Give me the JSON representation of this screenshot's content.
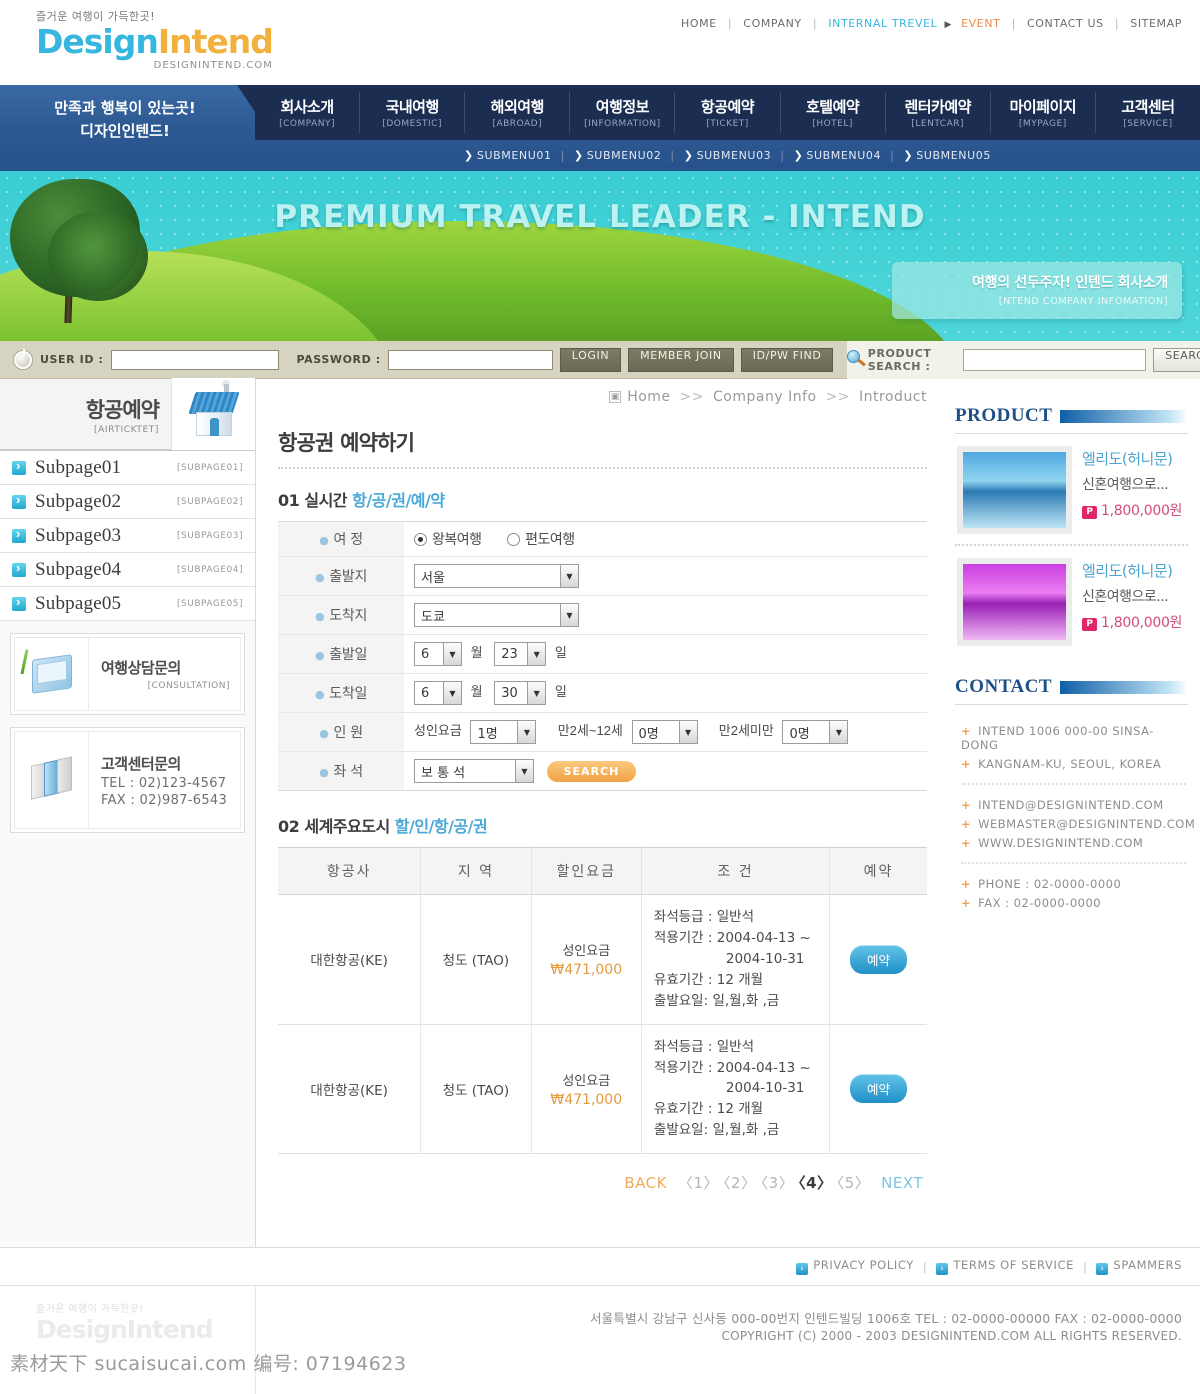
{
  "header": {
    "logo_tagline": "즐거운 여행이 가득한곳!",
    "logo_part1": "Design",
    "logo_part2": "Intend",
    "logo_domain": "DESIGNINTEND.COM",
    "topnav": [
      {
        "label": "HOME",
        "style": "plain"
      },
      {
        "label": "COMPANY",
        "style": "plain"
      },
      {
        "label": "INTERNAL TREVEL",
        "style": "blue"
      },
      {
        "label": "EVENT",
        "style": "orange"
      },
      {
        "label": "CONTACT US",
        "style": "plain"
      },
      {
        "label": "SITEMAP",
        "style": "plain"
      }
    ]
  },
  "navband": {
    "slogan_line1": "만족과 행복이 있는곳!",
    "slogan_line2": "디자인인텐드!",
    "menu": [
      {
        "ko": "회사소개",
        "en": "[COMPANY]"
      },
      {
        "ko": "국내여행",
        "en": "[DOMESTIC]"
      },
      {
        "ko": "해외여행",
        "en": "[ABROAD]"
      },
      {
        "ko": "여행정보",
        "en": "[INFORMATION]"
      },
      {
        "ko": "항공예약",
        "en": "[TICKET]"
      },
      {
        "ko": "호텔예약",
        "en": "[HOTEL]"
      },
      {
        "ko": "렌터카예약",
        "en": "[LENTCAR]"
      },
      {
        "ko": "마이페이지",
        "en": "[MYPAGE]"
      },
      {
        "ko": "고객센터",
        "en": "[SERVICE]"
      }
    ],
    "submenu": [
      "SUBMENU01",
      "SUBMENU02",
      "SUBMENU03",
      "SUBMENU04",
      "SUBMENU05"
    ]
  },
  "banner": {
    "title": "PREMIUM TRAVEL LEADER - INTEND",
    "callout_ko": "여행의 선두주자! 인텐드 회사소개",
    "callout_en": "[NTEND COMPANY INFOMATION]"
  },
  "loginbar": {
    "userid_label": "USER ID :",
    "userid_value": "",
    "password_label": "PASSWORD :",
    "password_value": "",
    "login_button": "LOGIN",
    "member_join_button": "MEMBER JOIN",
    "idpw_find_button": "ID/PW FIND",
    "product_search_label": "PRODUCT SEARCH :",
    "product_search_value": "",
    "search_button": "SEARCH"
  },
  "sidebar": {
    "head_ko": "항공예약",
    "head_en": "[AIRTICKTET]",
    "items": [
      {
        "label": "Subpage01",
        "code": "[SUBPAGE01]"
      },
      {
        "label": "Subpage02",
        "code": "[SUBPAGE02]"
      },
      {
        "label": "Subpage03",
        "code": "[SUBPAGE03]"
      },
      {
        "label": "Subpage04",
        "code": "[SUBPAGE04]"
      },
      {
        "label": "Subpage05",
        "code": "[SUBPAGE05]"
      }
    ],
    "consultation": {
      "ko": "여행상담문의",
      "en": "[CONSULTATION]"
    },
    "service_center": {
      "ko": "고객센터문의",
      "tel": "TEL : 02)123-4567",
      "fax": "FAX : 02)987-6543"
    }
  },
  "main": {
    "breadcrumb": [
      "Home",
      "Company Info",
      "Introduct"
    ],
    "breadcrumb_sep": ">>",
    "page_title": "항공권 예약하기",
    "section1": {
      "number": "01",
      "text": "실시간",
      "highlight": "항/공/권/예/약",
      "rows": {
        "itinerary_label": "여  정",
        "itinerary_opt1": "왕복여행",
        "itinerary_opt2": "편도여행",
        "departure_label": "출발지",
        "departure_value": "서울",
        "arrival_label": "도착지",
        "arrival_value": "도쿄",
        "depart_date_label": "출발일",
        "depart_month": "6",
        "depart_month_unit": "월",
        "depart_day": "23",
        "depart_day_unit": "일",
        "arrive_date_label": "도착일",
        "arrive_month": "6",
        "arrive_month_unit": "월",
        "arrive_day": "30",
        "arrive_day_unit": "일",
        "pax_label": "인  원",
        "adult_text": "성인요금",
        "adult_value": "1명",
        "child_text": "만2세~12세",
        "child_value": "0명",
        "infant_text": "만2세미만",
        "infant_value": "0명",
        "seat_label": "좌  석",
        "seat_value": "보 통 석",
        "search_button": "SEARCH"
      }
    },
    "section2": {
      "number": "02",
      "text": "세계주요도시",
      "highlight": "할/인/항/공/권",
      "columns": [
        "항공사",
        "지   역",
        "할인요금",
        "조         건",
        "예약"
      ],
      "rows": [
        {
          "airline": "대한항공(KE)",
          "region": "청도 (TAO)",
          "fare_label": "성인요금",
          "fare_value": "₩471,000",
          "cond_seat": "좌석등급 : 일반석",
          "cond_period": "적용기간 : 2004-04-13 ~",
          "cond_period2": "2004-10-31",
          "cond_valid": "유효기간 : 12 개월",
          "cond_days": "출발요일: 일,월,화 ,금",
          "book_button": "예약"
        },
        {
          "airline": "대한항공(KE)",
          "region": "청도 (TAO)",
          "fare_label": "성인요금",
          "fare_value": "₩471,000",
          "cond_seat": "좌석등급 : 일반석",
          "cond_period": "적용기간 : 2004-04-13 ~",
          "cond_period2": "2004-10-31",
          "cond_valid": "유효기간 : 12 개월",
          "cond_days": "출발요일: 일,월,화 ,금",
          "book_button": "예약"
        }
      ]
    },
    "pager": {
      "back": "BACK",
      "pages": [
        "〈1〉",
        "〈2〉",
        "〈3〉",
        "〈4〉",
        "〈5〉"
      ],
      "current_index": 3,
      "next": "NEXT"
    }
  },
  "right": {
    "product_heading": "PRODUCT",
    "products": [
      {
        "name": "엘리도(허니문)",
        "desc": "신혼여행으로...",
        "badge": "P",
        "price": "1,800,000원"
      },
      {
        "name": "엘리도(허니문)",
        "desc": "신혼여행으로...",
        "badge": "P",
        "price": "1,800,000원"
      }
    ],
    "contact_heading": "CONTACT",
    "contact_groups": [
      [
        "INTEND 1006 000-00 SINSA-DONG",
        "KANGNAM-KU, SEOUL, KOREA"
      ],
      [
        "INTEND@DESIGNINTEND.COM",
        "WEBMASTER@DESIGNINTEND.COM",
        "WWW.DESIGNINTEND.COM"
      ],
      [
        "PHONE : 02-0000-0000",
        "FAX : 02-0000-0000"
      ]
    ]
  },
  "footer": {
    "links": [
      "PRIVACY POLICY",
      "TERMS OF SERVICE",
      "SPAMMERS"
    ],
    "logo_tagline": "즐거운 여행이 가득한곳!",
    "logo_text": "DesignIntend",
    "address": "서울특별시  강남구 신사동 000-00번지 인텐드빌딩 1006호  TEL : 02-0000-00000  FAX : 02-0000-0000",
    "copyright": "COPYRIGHT (C) 2000 - 2003 DESIGNINTEND.COM  ALL RIGHTS RESERVED.",
    "watermark": "素材天下 sucaisucai.com  编号: 07194623"
  }
}
